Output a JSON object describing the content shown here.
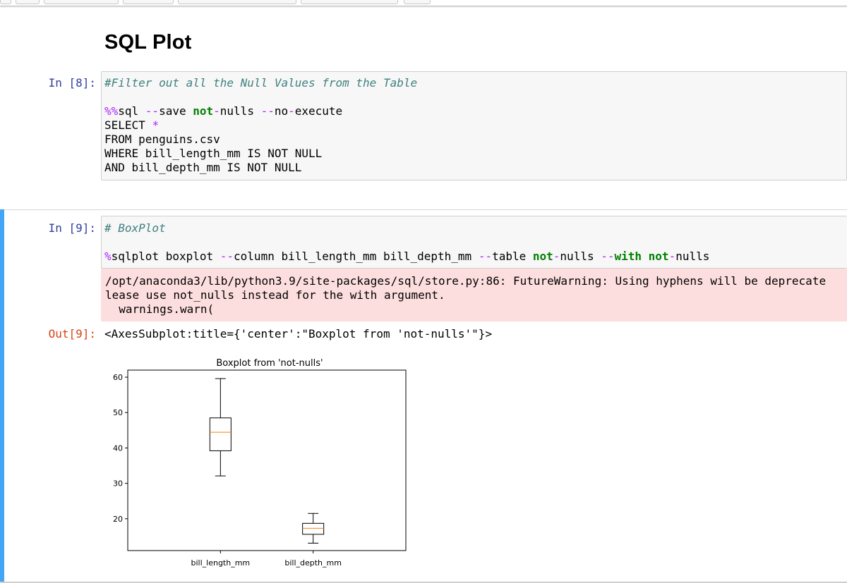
{
  "notebook": {
    "markdown_title": "SQL Plot",
    "cells": [
      {
        "prompt": "In [8]:",
        "lines": [
          "#Filter out all the Null Values from the Table",
          "",
          "%%sql --save not-nulls --no-execute",
          "SELECT *",
          "FROM penguins.csv",
          "WHERE bill_length_mm IS NOT NULL",
          "AND bill_depth_mm IS NOT NULL"
        ]
      },
      {
        "prompt": "In [9]:",
        "lines": [
          "# BoxPlot",
          "",
          "%sqlplot boxplot --column bill_length_mm bill_depth_mm --table not-nulls --with not-nulls"
        ],
        "stderr": [
          "/opt/anaconda3/lib/python3.9/site-packages/sql/store.py:86: FutureWarning: Using hyphens will be deprecate",
          "lease use not_nulls instead for the with argument.",
          "  warnings.warn("
        ],
        "out_prompt": "Out[9]:",
        "out_text": "<AxesSubplot:title={'center':\"Boxplot from 'not-nulls'\"}>"
      }
    ]
  },
  "colors": {
    "in_prompt": "#303f9f",
    "out_prompt": "#d84315",
    "comment": "#408080",
    "magic": "#aa22ff",
    "keyword": "#008000",
    "stderr_bg": "#fddede",
    "selected_cell_bar": "#42a5f5",
    "median": "#ff7f0e"
  },
  "chart_data": {
    "type": "boxplot",
    "title": "Boxplot from 'not-nulls'",
    "categories": [
      "bill_length_mm",
      "bill_depth_mm"
    ],
    "ylim": [
      11,
      62
    ],
    "yticks": [
      20,
      30,
      40,
      50,
      60
    ],
    "grid": false,
    "boxes": [
      {
        "name": "bill_length_mm",
        "whislo": 32.1,
        "q1": 39.2,
        "med": 44.45,
        "q3": 48.5,
        "whishi": 59.6
      },
      {
        "name": "bill_depth_mm",
        "whislo": 13.1,
        "q1": 15.6,
        "med": 17.3,
        "q3": 18.7,
        "whishi": 21.5
      }
    ]
  }
}
